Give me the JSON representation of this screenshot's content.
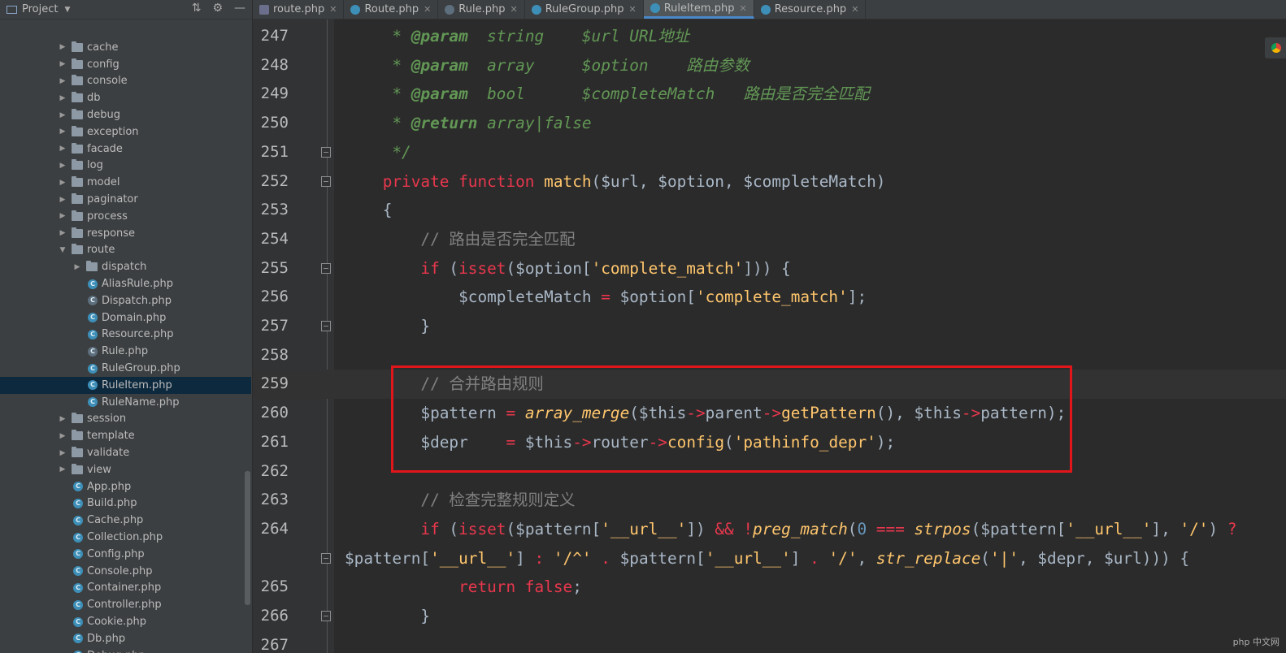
{
  "sidebar": {
    "title": "Project",
    "items": [
      {
        "label": "cache",
        "type": "folder",
        "depth": 1,
        "expanded": false
      },
      {
        "label": "config",
        "type": "folder",
        "depth": 1,
        "expanded": false
      },
      {
        "label": "console",
        "type": "folder",
        "depth": 1,
        "expanded": false
      },
      {
        "label": "db",
        "type": "folder",
        "depth": 1,
        "expanded": false
      },
      {
        "label": "debug",
        "type": "folder",
        "depth": 1,
        "expanded": false
      },
      {
        "label": "exception",
        "type": "folder",
        "depth": 1,
        "expanded": false
      },
      {
        "label": "facade",
        "type": "folder",
        "depth": 1,
        "expanded": false
      },
      {
        "label": "log",
        "type": "folder",
        "depth": 1,
        "expanded": false
      },
      {
        "label": "model",
        "type": "folder",
        "depth": 1,
        "expanded": false
      },
      {
        "label": "paginator",
        "type": "folder",
        "depth": 1,
        "expanded": false
      },
      {
        "label": "process",
        "type": "folder",
        "depth": 1,
        "expanded": false
      },
      {
        "label": "response",
        "type": "folder",
        "depth": 1,
        "expanded": false
      },
      {
        "label": "route",
        "type": "folder",
        "depth": 1,
        "expanded": true
      },
      {
        "label": "dispatch",
        "type": "folder",
        "depth": 2,
        "expanded": false
      },
      {
        "label": "AliasRule.php",
        "type": "class",
        "depth": 2
      },
      {
        "label": "Dispatch.php",
        "type": "abstract",
        "depth": 2
      },
      {
        "label": "Domain.php",
        "type": "class",
        "depth": 2
      },
      {
        "label": "Resource.php",
        "type": "class",
        "depth": 2
      },
      {
        "label": "Rule.php",
        "type": "abstract",
        "depth": 2
      },
      {
        "label": "RuleGroup.php",
        "type": "class",
        "depth": 2
      },
      {
        "label": "RuleItem.php",
        "type": "class",
        "depth": 2,
        "selected": true
      },
      {
        "label": "RuleName.php",
        "type": "class",
        "depth": 2
      },
      {
        "label": "session",
        "type": "folder",
        "depth": 1,
        "expanded": false
      },
      {
        "label": "template",
        "type": "folder",
        "depth": 1,
        "expanded": false
      },
      {
        "label": "validate",
        "type": "folder",
        "depth": 1,
        "expanded": false
      },
      {
        "label": "view",
        "type": "folder",
        "depth": 1,
        "expanded": false
      },
      {
        "label": "App.php",
        "type": "class",
        "depth": 1
      },
      {
        "label": "Build.php",
        "type": "class",
        "depth": 1
      },
      {
        "label": "Cache.php",
        "type": "class",
        "depth": 1
      },
      {
        "label": "Collection.php",
        "type": "class",
        "depth": 1
      },
      {
        "label": "Config.php",
        "type": "class",
        "depth": 1
      },
      {
        "label": "Console.php",
        "type": "class",
        "depth": 1
      },
      {
        "label": "Container.php",
        "type": "class",
        "depth": 1
      },
      {
        "label": "Controller.php",
        "type": "class",
        "depth": 1
      },
      {
        "label": "Cookie.php",
        "type": "class",
        "depth": 1
      },
      {
        "label": "Db.php",
        "type": "class",
        "depth": 1
      },
      {
        "label": "Debug.php",
        "type": "class",
        "depth": 1
      }
    ]
  },
  "tabs": [
    {
      "label": "route.php",
      "icon": "php-file-icon",
      "active": false
    },
    {
      "label": "Route.php",
      "icon": "class-icon",
      "active": false
    },
    {
      "label": "Rule.php",
      "icon": "abstract-class-icon",
      "active": false
    },
    {
      "label": "RuleGroup.php",
      "icon": "class-icon",
      "active": false
    },
    {
      "label": "RuleItem.php",
      "icon": "class-icon",
      "active": true
    },
    {
      "label": "Resource.php",
      "icon": "class-icon",
      "active": false
    }
  ],
  "editor": {
    "current_line": 259,
    "lines": [
      {
        "num": "247",
        "fold": false,
        "tokens": [
          [
            "doc",
            "     * "
          ],
          [
            "doctag",
            "@param"
          ],
          [
            "doc",
            "  string    $url URL地址"
          ]
        ]
      },
      {
        "num": "248",
        "fold": false,
        "tokens": [
          [
            "doc",
            "     * "
          ],
          [
            "doctag",
            "@param"
          ],
          [
            "doc",
            "  array     $option    路由参数"
          ]
        ]
      },
      {
        "num": "249",
        "fold": false,
        "tokens": [
          [
            "doc",
            "     * "
          ],
          [
            "doctag",
            "@param"
          ],
          [
            "doc",
            "  bool      $completeMatch   路由是否完全匹配"
          ]
        ]
      },
      {
        "num": "250",
        "fold": false,
        "tokens": [
          [
            "doc",
            "     * "
          ],
          [
            "doctag",
            "@return"
          ],
          [
            "doc",
            " array|false"
          ]
        ]
      },
      {
        "num": "251",
        "fold": true,
        "tokens": [
          [
            "doc",
            "     */"
          ]
        ]
      },
      {
        "num": "252",
        "fold": true,
        "tokens": [
          [
            "pink",
            "    private function "
          ],
          [
            "fn",
            "match"
          ],
          [
            "var",
            "($url, $option, $completeMatch)"
          ]
        ]
      },
      {
        "num": "253",
        "fold": false,
        "tokens": [
          [
            "var",
            "    {"
          ]
        ]
      },
      {
        "num": "254",
        "fold": false,
        "tokens": [
          [
            "cm",
            "        // 路由是否完全匹配"
          ]
        ]
      },
      {
        "num": "255",
        "fold": true,
        "tokens": [
          [
            "pink",
            "        if "
          ],
          [
            "var",
            "("
          ],
          [
            "pink",
            "isset"
          ],
          [
            "var",
            "($option["
          ],
          [
            "fn",
            "'complete_match'"
          ],
          [
            "var",
            "])) {"
          ]
        ]
      },
      {
        "num": "256",
        "fold": false,
        "tokens": [
          [
            "var",
            "            $completeMatch "
          ],
          [
            "pink",
            "="
          ],
          [
            "var",
            " $option["
          ],
          [
            "fn",
            "'complete_match'"
          ],
          [
            "var",
            "];"
          ]
        ]
      },
      {
        "num": "257",
        "fold": true,
        "tokens": [
          [
            "var",
            "        }"
          ]
        ]
      },
      {
        "num": "258",
        "fold": false,
        "tokens": []
      },
      {
        "num": "259",
        "fold": false,
        "tokens": [
          [
            "cm",
            "        // 合并路由规则"
          ]
        ]
      },
      {
        "num": "260",
        "fold": false,
        "tokens": [
          [
            "var",
            "        $pattern "
          ],
          [
            "pink",
            "="
          ],
          [
            "ifn",
            " array_merge"
          ],
          [
            "var",
            "($this"
          ],
          [
            "pink",
            "->"
          ],
          [
            "var",
            "parent"
          ],
          [
            "pink",
            "->"
          ],
          [
            "fn",
            "getPattern"
          ],
          [
            "var",
            "(), $this"
          ],
          [
            "pink",
            "->"
          ],
          [
            "var",
            "pattern);"
          ]
        ]
      },
      {
        "num": "261",
        "fold": false,
        "tokens": [
          [
            "var",
            "        $depr    "
          ],
          [
            "pink",
            "="
          ],
          [
            "var",
            " $this"
          ],
          [
            "pink",
            "->"
          ],
          [
            "var",
            "router"
          ],
          [
            "pink",
            "->"
          ],
          [
            "fn",
            "config"
          ],
          [
            "var",
            "("
          ],
          [
            "fn",
            "'pathinfo_depr'"
          ],
          [
            "var",
            ");"
          ]
        ]
      },
      {
        "num": "262",
        "fold": false,
        "tokens": []
      },
      {
        "num": "263",
        "fold": false,
        "tokens": [
          [
            "cm",
            "        // 检查完整规则定义"
          ]
        ]
      },
      {
        "num": "264",
        "fold": false,
        "tokens": [
          [
            "pink",
            "        if "
          ],
          [
            "var",
            "("
          ],
          [
            "pink",
            "isset"
          ],
          [
            "var",
            "($pattern["
          ],
          [
            "fn",
            "'__url__'"
          ],
          [
            "var",
            "]) "
          ],
          [
            "pink",
            "&& !"
          ],
          [
            "ifn",
            "preg_match"
          ],
          [
            "var",
            "("
          ],
          [
            "num",
            "0"
          ],
          [
            "pink",
            " === "
          ],
          [
            "ifn",
            "strpos"
          ],
          [
            "var",
            "($pattern["
          ],
          [
            "fn",
            "'__url__'"
          ],
          [
            "var",
            "], "
          ],
          [
            "fn",
            "'/'"
          ],
          [
            "var",
            ") "
          ],
          [
            "pink",
            "?"
          ]
        ]
      },
      {
        "num": "",
        "fold": true,
        "tokens": [
          [
            "var",
            "$pattern["
          ],
          [
            "fn",
            "'__url__'"
          ],
          [
            "var",
            "] "
          ],
          [
            "pink",
            ":"
          ],
          [
            "fn",
            " '/^'"
          ],
          [
            "pink",
            " ."
          ],
          [
            "var",
            " $pattern["
          ],
          [
            "fn",
            "'__url__'"
          ],
          [
            "var",
            "] "
          ],
          [
            "pink",
            "."
          ],
          [
            "fn",
            " '/'"
          ],
          [
            "var",
            ", "
          ],
          [
            "ifn",
            "str_replace"
          ],
          [
            "var",
            "("
          ],
          [
            "fn",
            "'|'"
          ],
          [
            "var",
            ", $depr, $url))) {"
          ]
        ]
      },
      {
        "num": "265",
        "fold": false,
        "tokens": [
          [
            "pink",
            "            return false"
          ],
          [
            "var",
            ";"
          ]
        ]
      },
      {
        "num": "266",
        "fold": true,
        "tokens": [
          [
            "var",
            "        }"
          ]
        ]
      },
      {
        "num": "267",
        "fold": false,
        "tokens": []
      }
    ]
  },
  "watermark": "php 中文网"
}
